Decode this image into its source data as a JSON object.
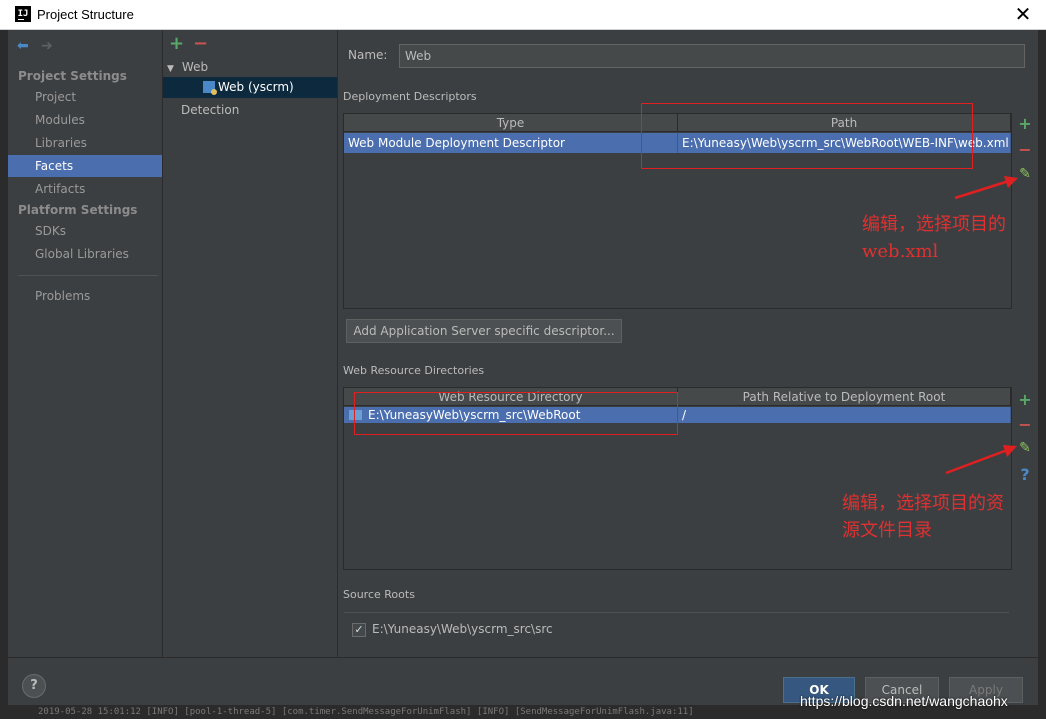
{
  "window": {
    "title": "Project Structure",
    "app_icon": "IJ"
  },
  "nav": {
    "back_icon": "back-arrow-icon",
    "forward_icon": "forward-arrow-icon",
    "project_settings_header": "Project Settings",
    "platform_settings_header": "Platform Settings",
    "items": [
      {
        "label": "Project"
      },
      {
        "label": "Modules"
      },
      {
        "label": "Libraries"
      },
      {
        "label": "Facets",
        "selected": true
      },
      {
        "label": "Artifacts"
      },
      {
        "label": "SDKs"
      },
      {
        "label": "Global Libraries"
      },
      {
        "label": "Problems"
      }
    ]
  },
  "tree": {
    "add": "+",
    "remove": "−",
    "root_label": "Web",
    "facet_label": "Web (yscrm)",
    "detection_label": "Detection"
  },
  "main": {
    "name_label": "Name:",
    "name_value": "Web",
    "deployment_title": "Deployment Descriptors",
    "deployment_columns": [
      "Type",
      "Path"
    ],
    "deployment_row": {
      "type": "Web Module Deployment Descriptor",
      "path": "E:\\Yuneasy\\Web\\yscrm_src\\WebRoot\\WEB-INF\\web.xml"
    },
    "add_descriptor_button": "Add Application Server specific descriptor...",
    "resource_title": "Web Resource Directories",
    "resource_columns": [
      "Web Resource Directory",
      "Path Relative to Deployment Root"
    ],
    "resource_row": {
      "directory": "E:\\YuneasyWeb\\yscrm_src\\WebRoot",
      "relative": "/"
    },
    "source_roots_title": "Source Roots",
    "source_root_path": "E:\\Yuneasy\\Web\\yscrm_src\\src",
    "source_root_checked": true
  },
  "tools": {
    "add": "+",
    "remove": "−",
    "edit": "✎",
    "help": "?"
  },
  "buttons": {
    "help": "?",
    "ok": "OK",
    "cancel": "Cancel",
    "apply": "Apply"
  },
  "annotations": {
    "first_line1": "编辑，选择项目的",
    "first_line2": "web.xml",
    "second_line1": "编辑，选择项目的资",
    "second_line2": "源文件目录"
  },
  "watermark": "https://blog.csdn.net/wangchaohx",
  "background_log": "2019-05-28 15:01:12 [INFO] [pool-1-thread-5] [com.timer.SendMessageForUnimFlash] [INFO] [SendMessageForUnimFlash.java:11]"
}
